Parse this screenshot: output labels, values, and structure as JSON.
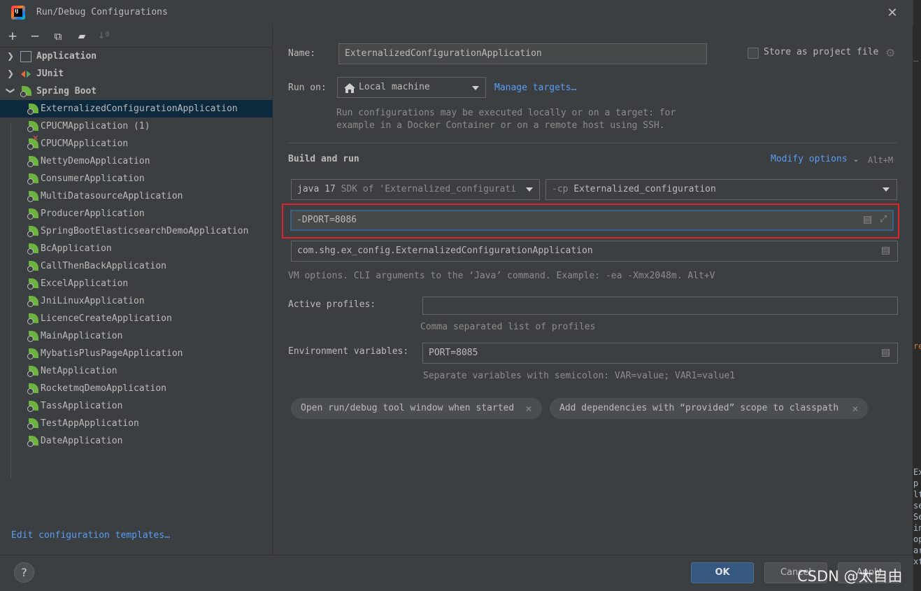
{
  "window": {
    "title": "Run/Debug Configurations",
    "app_icon_text": "IJ"
  },
  "toolbar": {
    "add": "+",
    "remove": "−",
    "copy": "⧉",
    "folder": "▰",
    "sort": "↓ª"
  },
  "tree": {
    "groups": [
      {
        "label": "Application",
        "expanded": false
      },
      {
        "label": "JUnit",
        "expanded": false
      },
      {
        "label": "Spring Boot",
        "expanded": true
      }
    ],
    "items": [
      {
        "label": "ExternalizedConfigurationApplication",
        "selected": true,
        "error": false
      },
      {
        "label": "CPUCMApplication (1)",
        "selected": false,
        "error": false
      },
      {
        "label": "CPUCMApplication",
        "selected": false,
        "error": true
      },
      {
        "label": "NettyDemoApplication",
        "selected": false,
        "error": false
      },
      {
        "label": "ConsumerApplication",
        "selected": false,
        "error": false
      },
      {
        "label": "MultiDatasourceApplication",
        "selected": false,
        "error": false
      },
      {
        "label": "ProducerApplication",
        "selected": false,
        "error": false
      },
      {
        "label": "SpringBootElasticsearchDemoApplication",
        "selected": false,
        "error": false
      },
      {
        "label": "BcApplication",
        "selected": false,
        "error": false
      },
      {
        "label": "CallThenBackApplication",
        "selected": false,
        "error": false
      },
      {
        "label": "ExcelApplication",
        "selected": false,
        "error": false
      },
      {
        "label": "JniLinuxApplication",
        "selected": false,
        "error": false
      },
      {
        "label": "LicenceCreateApplication",
        "selected": false,
        "error": false
      },
      {
        "label": "MainApplication",
        "selected": false,
        "error": false
      },
      {
        "label": "MybatisPlusPageApplication",
        "selected": false,
        "error": false
      },
      {
        "label": "NetApplication",
        "selected": false,
        "error": false
      },
      {
        "label": "RocketmqDemoApplication",
        "selected": false,
        "error": false
      },
      {
        "label": "TassApplication",
        "selected": false,
        "error": false
      },
      {
        "label": "TestAppApplication",
        "selected": false,
        "error": false
      },
      {
        "label": "DateApplication",
        "selected": false,
        "error": false
      }
    ],
    "edit_templates_link": "Edit configuration templates…"
  },
  "form": {
    "name_label": "Name:",
    "name_value": "ExternalizedConfigurationApplication",
    "store_label": "Store as project file",
    "store_checked": false,
    "run_on_label": "Run on:",
    "run_on_value": "Local machine",
    "manage_targets": "Manage targets…",
    "run_on_hint_1": "Run configurations may be executed locally or on a target: for",
    "run_on_hint_2": "example in a Docker Container or on a remote host using SSH.",
    "build_and_run": "Build and run",
    "modify_options": "Modify options",
    "modify_shortcut": "Alt+M",
    "jdk_main": "java 17",
    "jdk_sub": "SDK of 'Externalized_configurati",
    "cp_prefix": "-cp",
    "cp_value": "Externalized_configuration",
    "vm_options": "-DPORT=8086",
    "main_class": "com.shg.ex_config.ExternalizedConfigurationApplication",
    "vm_hint": "VM options. CLI arguments to the ‘Java’ command. Example: -ea -Xmx2048m. Alt+V",
    "profiles_label": "Active profiles:",
    "profiles_value": "",
    "profiles_hint": "Comma separated list of profiles",
    "env_label": "Environment variables:",
    "env_value": "PORT=8085",
    "env_hint": "Separate variables with semicolon: VAR=value; VAR1=value1",
    "chips": [
      "Open run/debug tool window when started",
      "Add dependencies with “provided” scope to classpath"
    ]
  },
  "footer": {
    "help": "?",
    "ok": "OK",
    "cancel": "Cancel",
    "apply": "Apply"
  },
  "watermark": "CSDN @太自由",
  "colors": {
    "accent_link": "#589df6",
    "selection": "#0d293e",
    "highlight_box": "#e0242b",
    "spring_green": "#6db33f"
  }
}
